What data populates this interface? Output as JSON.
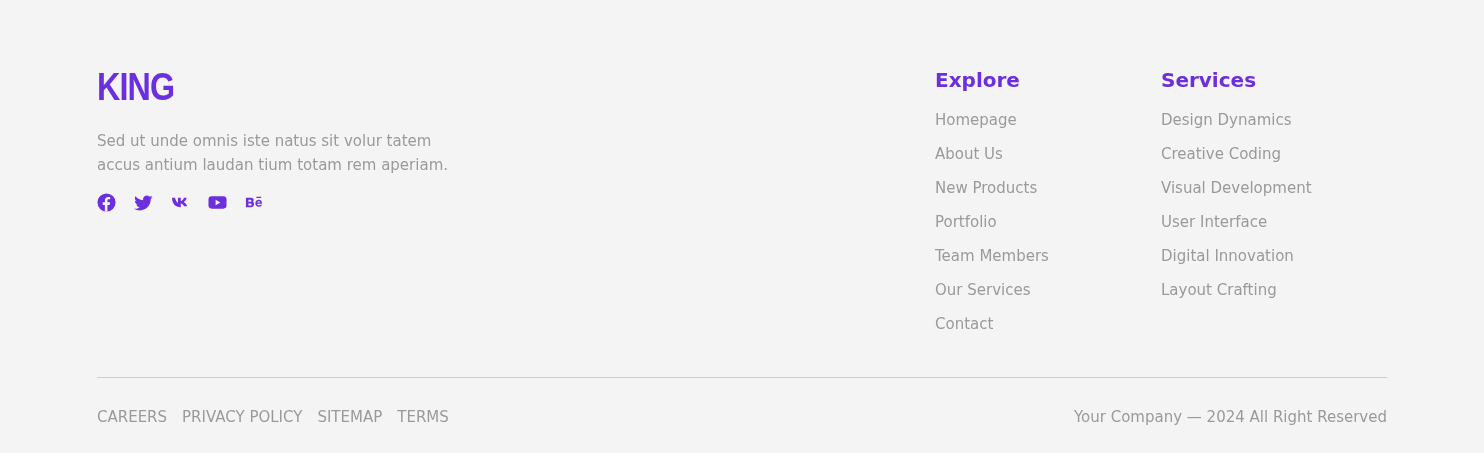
{
  "brand": {
    "logo": "KING",
    "description": "Sed ut unde omnis iste natus sit volur tatem accus antium laudan tium totam rem aperiam."
  },
  "social": [
    {
      "kind": "facebook"
    },
    {
      "kind": "twitter"
    },
    {
      "kind": "vk"
    },
    {
      "kind": "youtube"
    },
    {
      "kind": "behance"
    }
  ],
  "columns": [
    {
      "title": "Explore",
      "links": [
        "Homepage",
        "About Us",
        "New Products",
        "Portfolio",
        "Team Members",
        "Our Services",
        "Contact"
      ]
    },
    {
      "title": "Services",
      "links": [
        "Design Dynamics",
        "Creative Coding",
        "Visual Development",
        "User Interface",
        "Digital Innovation",
        "Layout Crafting"
      ]
    }
  ],
  "bottom_links": [
    "CAREERS",
    "PRIVACY POLICY",
    "SITEMAP",
    "TERMS"
  ],
  "copyright": "Your Company — 2024 All Right Reserved"
}
